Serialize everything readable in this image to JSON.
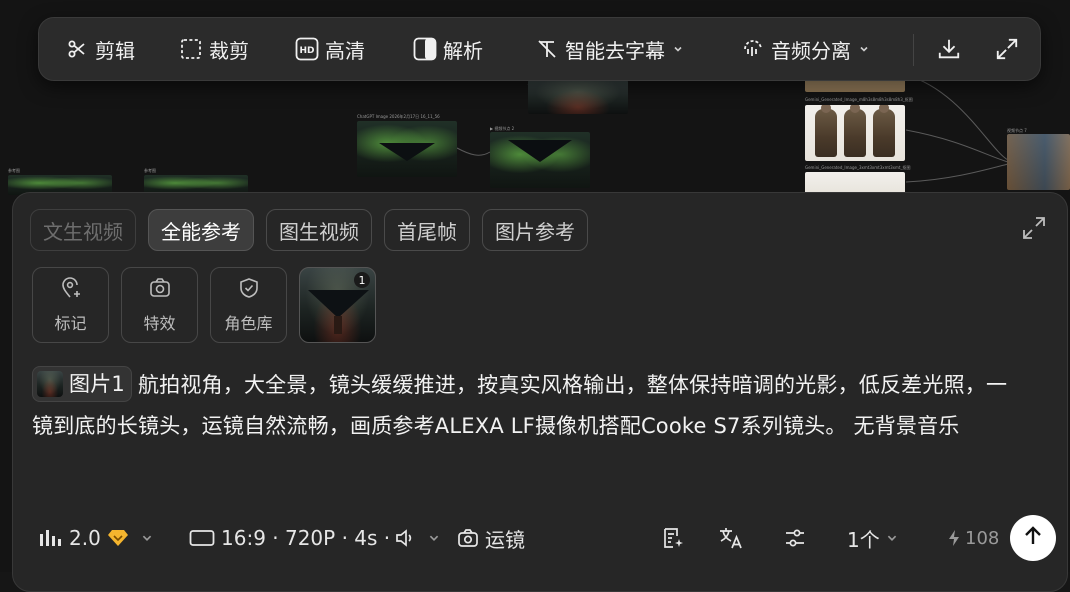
{
  "colors": {
    "background": "#161616",
    "toolbar_bg": "#2b2b2b",
    "panel_bg": "#262626",
    "text": "#f0f0f0",
    "muted": "#9a9a9a",
    "vip_badge": "#f5b52e",
    "send_button": "#ffffff"
  },
  "toolbar": {
    "items": [
      {
        "label": "剪辑",
        "icon": "scissors-icon"
      },
      {
        "label": "裁剪",
        "icon": "crop-icon"
      },
      {
        "label": "高清",
        "icon": "hd-icon"
      },
      {
        "label": "解析",
        "icon": "split-icon"
      },
      {
        "label": "智能去字幕",
        "icon": "remove-subtitle-icon"
      },
      {
        "label": "音频分离",
        "icon": "audio-separate-icon"
      }
    ],
    "download_icon": "download-icon",
    "fullscreen_icon": "fullscreen-icon"
  },
  "mode_tabs": [
    {
      "label": "文生视频",
      "state": "disabled"
    },
    {
      "label": "全能参考",
      "state": "active"
    },
    {
      "label": "图生视频",
      "state": "normal"
    },
    {
      "label": "首尾帧",
      "state": "normal"
    },
    {
      "label": "图片参考",
      "state": "normal"
    }
  ],
  "tools": [
    {
      "label": "标记",
      "icon": "marker-pin-icon"
    },
    {
      "label": "特效",
      "icon": "camera-effect-icon"
    },
    {
      "label": "角色库",
      "icon": "shield-check-icon"
    }
  ],
  "reference": {
    "badge": "1"
  },
  "prompt": {
    "chip_label": "图片1",
    "text": "航拍视角，大全景，镜头缓缓推进，按真实风格输出，整体保持暗调的光影，低反差光照，一镜到底的长镜头，运镜自然流畅，画质参考ALEXA LF摄像机搭配Cooke S7系列镜头。 无背景音乐"
  },
  "bottom_bar": {
    "model_version": "2.0",
    "format": "16:9 · 720P · 4s ·",
    "camera_move": "运镜",
    "count": "1个",
    "credits": "108"
  },
  "canvas": {
    "captions": [
      "ChatGPT Image 2026年2月17日 16_11_56",
      "▶ 视频节点 2",
      "Gemini_Generated_Image_m8h3s8m8h3s8m8h3_抠图",
      "Gemini_Generated_Image_3xmt3xmt3xmt3xmt_抠图",
      "视频节点 7",
      "参考图",
      "参考图"
    ]
  }
}
